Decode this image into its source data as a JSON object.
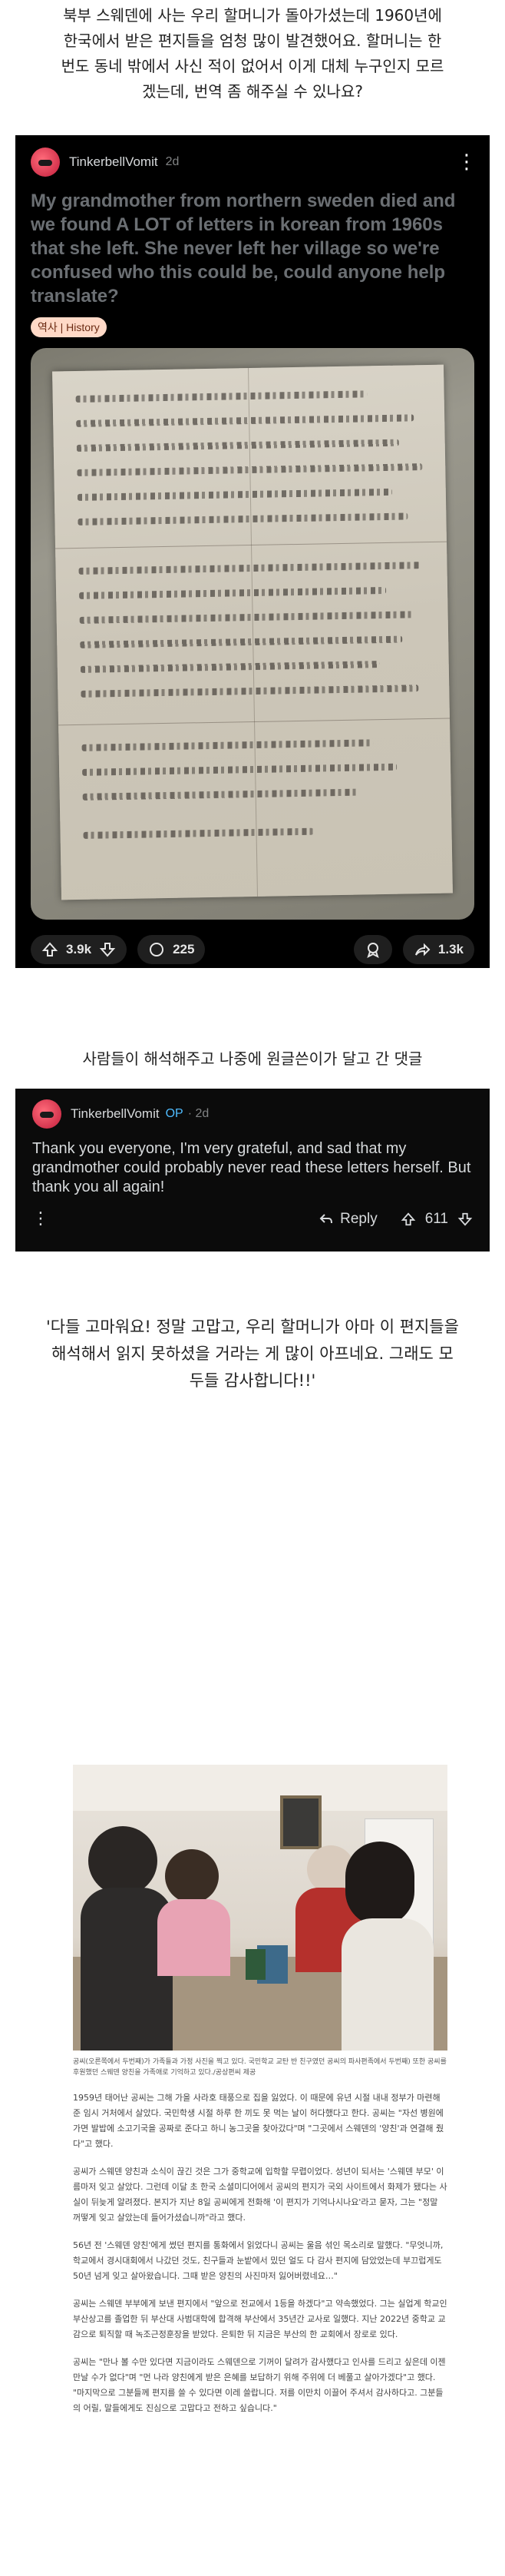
{
  "intro": {
    "line1": "북부 스웨덴에 사는 우리 할머니가 돌아가셨는데 1960년에",
    "line2": "한국에서 받은 편지들을 엄청 많이 발견했어요. 할머니는 한",
    "line3": "번도 동네 밖에서 사신 적이 없어서 이게 대체 누구인지 모르",
    "line4": "겠는데, 번역 좀 해주실 수 있나요?"
  },
  "post": {
    "author": "TinkerbellVomit",
    "age": "2d",
    "title": "My grandmother from northern sweden died and we found A LOT of letters in korean from 1960s that she left. She never left her village so we're confused who this could be, could anyone help translate?",
    "flair": "역사 | History",
    "votes": "3.9k",
    "comments": "225",
    "shares": "1.3k"
  },
  "caption_mid": "사람들이 해석해주고 나중에 원글쓴이가 달고 간 댓글",
  "comment": {
    "author": "TinkerbellVomit",
    "op_badge": "OP",
    "age": "· 2d",
    "body": "Thank you everyone, I'm very grateful, and sad that my grandmother could probably never read these letters herself. But thank you all again!",
    "reply_label": "Reply",
    "votes": "611"
  },
  "translation": {
    "line1": "'다들 고마워요! 정말 고맙고, 우리 할머니가 아마 이 편지들을",
    "line2": "해석해서 읽지 못하셨을 거라는 게 많이 아프네요. 그래도 모",
    "line3": "두들 감사합니다!!'"
  },
  "article": {
    "photo_caption": "공씨(오른쪽에서 두번째)가 가족들과 가정 사진을 찍고 있다. 국민학교 교탄 반 친구였던 공씨의 파사편족에서 두번째) 또한 공씨를 후원했던 스웨덴 양친을 가족애로 기억하고 있다./공상편씨 제공",
    "p1": "1959년 태어난 공씨는 그해 가을 사라호 태풍으로 집을 잃었다. 이 때문에 유년 시절 내내 정부가 마련해 준 임시 거처에서 살았다. 국민학생 시절 하루 한 끼도 못 먹는 날이 허다했다고 한다. 공씨는 \"자선 병원에 가면 발밥에 소고기국을 공짜로 준다고 하니 농그곳을 찾아갔다\"며 \"그곳에서 스웨덴의 '양친'과 연결해 줬다\"고 했다.",
    "p2": "공씨가 스웨덴 양친과 소식이 끊긴 것은 그가 중학교에 입학할 무렵이었다. 성년이 되서는 '스웨덴 부모' 이름마저 잊고 살았다. 그런데 이달 초 한국 소셜미디어에서 공씨의 편지가 국외 사이트에서 화제가 됐다는 사실이 뒤늦게 알려졌다. 본지가 지난 8일 공씨에게 전화해 '이 편지가 기억나시나요'라고 묻자, 그는 \"정말 꺼떻게 잊고 살았는데 들어가셨습니까\"라고 했다.",
    "p3": "56년 전 '스웨덴 양친'에게 썼던 편지를 통화에서 읽었다니 공씨는 울음 섞인 목소리로 말했다. \"무엇니까, 학교에서 경시대회에서 나갔던 것도, 친구들과 눈밭에서 밌던 얼도 다 감사 편지에 담았었는데 부끄럽게도 50년 넘게 잊고 살아왔습니다. 그때 받은 양친의 사진마저 잃어버렸네요…\"",
    "p4": "공씨는 스웨덴 부부에게 보낸 편지에서 \"앞으로 전교에서 1등을 하겠다\"고 약속했었다. 그는 실업계 학교인 부산상고를 졸업한 뒤 부산대 사범대학에 합격해 부산에서 35년간 교사로 일했다. 지난 2022년 중학교 교감으로 퇴직할 때 녹조근정훈장을 받았다. 은퇴한 뒤 지금은 부산의 한 교회에서 장로로 있다.",
    "p5": "공씨는 \"만나 볼 수만 있다면 지금이라도 스웨덴으로 기꺼이 달려가 감사했다고 인사를 드리고 싶은데 이젠 만날 수가 없다\"며 \"먼 나라 양친에게 받은 은혜를 보답하기 위해 주위에 더 베풀고 살아가겠다\"고 했다. \"마지막으로 그분들께 편지를 쓸 수 있다면 이레 쓸랍니다. 저를 이만치 이끌어 주셔서 감사하다고. 그분들의 어릴, 말들에게도 진심으로 고맙다고 전하고 싶습니다.\""
  },
  "colors": {
    "card_bg": "#000000",
    "title_gray": "#6b6f73",
    "op_blue": "#4fbcff",
    "flair_bg": "#ffd9c7"
  }
}
